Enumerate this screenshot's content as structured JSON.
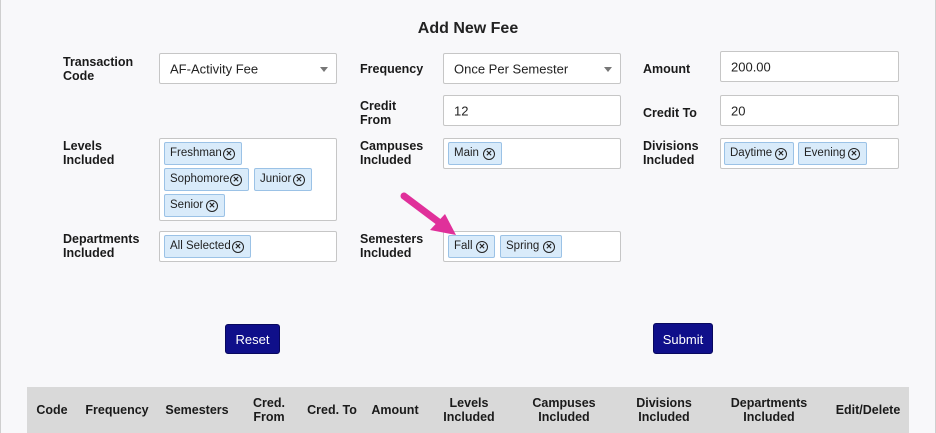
{
  "form": {
    "title": "Add New Fee",
    "transaction_code": {
      "label": "Transaction Code",
      "value": "AF-Activity Fee"
    },
    "frequency": {
      "label": "Frequency",
      "value": "Once Per Semester"
    },
    "amount": {
      "label": "Amount",
      "value": "200.00"
    },
    "credit_from": {
      "label": "Credit From",
      "value": "12"
    },
    "credit_to": {
      "label": "Credit To",
      "value": "20"
    },
    "levels": {
      "label": "Levels Included",
      "tags": [
        "Freshman",
        "Sophomore",
        "Junior",
        "Senior"
      ]
    },
    "campuses": {
      "label": "Campuses Included",
      "tags": [
        "Main"
      ]
    },
    "divisions": {
      "label": "Divisions Included",
      "tags": [
        "Daytime",
        "Evening"
      ]
    },
    "departments": {
      "label": "Departments Included",
      "tags": [
        "All Selected"
      ]
    },
    "semesters": {
      "label": "Semesters Included",
      "tags": [
        "Fall",
        "Spring"
      ]
    },
    "reset_label": "Reset",
    "submit_label": "Submit"
  },
  "table": {
    "headers": [
      "Code",
      "Frequency",
      "Semesters",
      "Cred. From",
      "Cred. To",
      "Amount",
      "Levels Included",
      "Campuses Included",
      "Divisions Included",
      "Departments Included",
      "Edit/Delete"
    ]
  },
  "colors": {
    "button": "#0f0f8a",
    "tag_bg": "#d9ebfa",
    "arrow": "#e0309a",
    "table_header": "#d9d9d9"
  },
  "icons": {
    "tag_remove": "close-circle-icon",
    "dropdown": "chevron-down-icon",
    "pointer": "arrow-icon"
  }
}
